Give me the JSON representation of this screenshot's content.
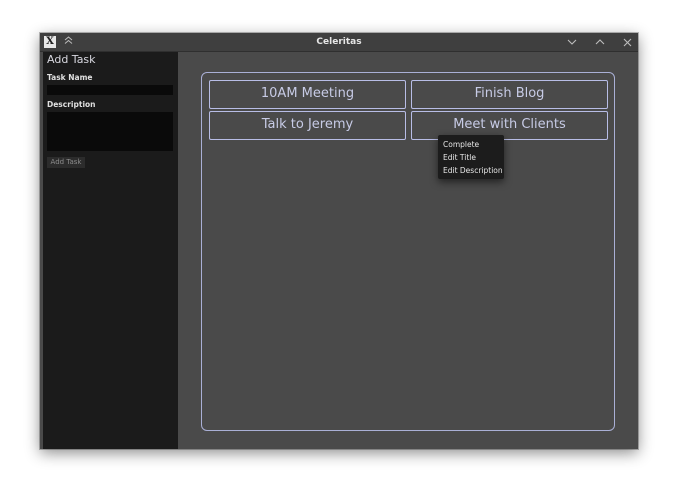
{
  "window": {
    "title": "Celeritas",
    "app_icon_glyph": "X"
  },
  "sidebar": {
    "heading": "Add Task",
    "task_name_label": "Task Name",
    "task_name_value": "",
    "description_label": "Description",
    "description_value": "",
    "add_button_label": "Add Task"
  },
  "board": {
    "tasks": [
      {
        "label": "10AM Meeting"
      },
      {
        "label": "Finish Blog"
      },
      {
        "label": "Talk to Jeremy"
      },
      {
        "label": "Meet with Clients"
      }
    ]
  },
  "context_menu": {
    "items": [
      {
        "label": "Complete"
      },
      {
        "label": "Edit Title"
      },
      {
        "label": "Edit Description"
      }
    ]
  },
  "colors": {
    "window_bg": "#4a4a4a",
    "sidebar_bg": "#1b1b1b",
    "accent_border": "#b8bde6",
    "task_text": "#c7cbe6"
  },
  "icons": {
    "app": "x-window-icon",
    "shade": "double-chevron-up-icon",
    "minimize": "chevron-down-icon",
    "maximize": "chevron-up-icon",
    "close": "close-icon"
  }
}
